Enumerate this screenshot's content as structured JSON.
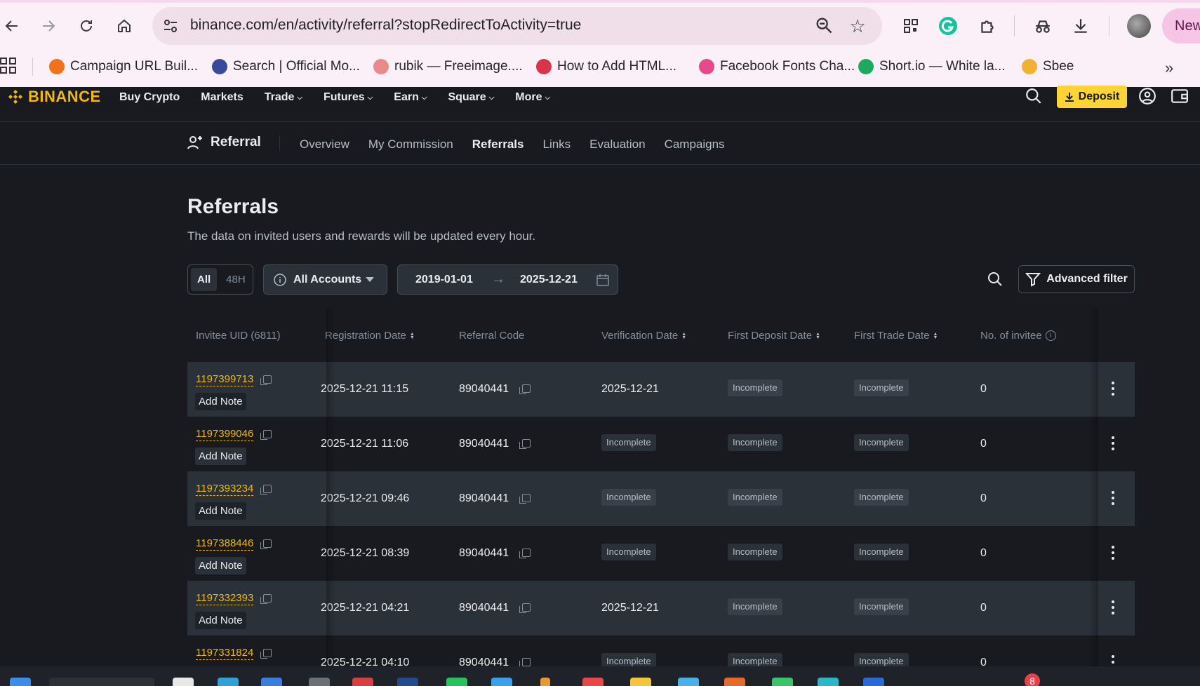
{
  "browser": {
    "url": "binance.com/en/activity/referral?stopRedirectToActivity=true",
    "new_label": "New",
    "bookmarks": [
      {
        "label": "Campaign URL Buil...",
        "color": "#f2711c"
      },
      {
        "label": "Search | Official Mo...",
        "color": "#3a4a9a"
      },
      {
        "label": "rubik — Freeimage....",
        "color": "#e88a8a"
      },
      {
        "label": "How to Add HTML...",
        "color": "#d9344a"
      },
      {
        "label": "Facebook Fonts Cha...",
        "color": "#e64a8c"
      },
      {
        "label": "Short.io — White la...",
        "color": "#1eaa5e"
      },
      {
        "label": "Sbee",
        "color": "#f2b134"
      }
    ]
  },
  "header": {
    "logo": "BINANCE",
    "nav": [
      {
        "label": "Buy Crypto",
        "has_menu": false
      },
      {
        "label": "Markets",
        "has_menu": false
      },
      {
        "label": "Trade",
        "has_menu": true
      },
      {
        "label": "Futures",
        "has_menu": true
      },
      {
        "label": "Earn",
        "has_menu": true
      },
      {
        "label": "Square",
        "has_menu": true
      },
      {
        "label": "More",
        "has_menu": true
      }
    ],
    "deposit_label": "Deposit",
    "accent": "#fcd535"
  },
  "subnav": {
    "title": "Referral",
    "tabs": [
      {
        "label": "Overview",
        "active": false
      },
      {
        "label": "My Commission",
        "active": false
      },
      {
        "label": "Referrals",
        "active": true
      },
      {
        "label": "Links",
        "active": false
      },
      {
        "label": "Evaluation",
        "active": false
      },
      {
        "label": "Campaigns",
        "active": false
      }
    ]
  },
  "page": {
    "title": "Referrals",
    "subtitle": "The data on invited users and rewards will be updated every hour."
  },
  "filters": {
    "range_options": [
      "All",
      "48H"
    ],
    "range_selected": "All",
    "account": "All Accounts",
    "date_from": "2019-01-01",
    "date_to": "2025-12-21",
    "advanced_filter": "Advanced filter"
  },
  "table": {
    "columns": {
      "uid": "Invitee UID (6811)",
      "registration": "Registration Date",
      "code": "Referral Code",
      "verification": "Verification Date",
      "first_deposit": "First Deposit Date",
      "first_trade": "First Trade Date",
      "invitees": "No. of invitee"
    },
    "add_note": "Add Note",
    "incomplete": "Incomplete",
    "rows": [
      {
        "uid": "1197399713",
        "registration": "2025-12-21 11:15",
        "code": "89040441",
        "verification": "2025-12-21",
        "first_deposit": "Incomplete",
        "first_trade": "Incomplete",
        "invitees": "0"
      },
      {
        "uid": "1197399046",
        "registration": "2025-12-21 11:06",
        "code": "89040441",
        "verification": "Incomplete",
        "first_deposit": "Incomplete",
        "first_trade": "Incomplete",
        "invitees": "0"
      },
      {
        "uid": "1197393234",
        "registration": "2025-12-21 09:46",
        "code": "89040441",
        "verification": "Incomplete",
        "first_deposit": "Incomplete",
        "first_trade": "Incomplete",
        "invitees": "0"
      },
      {
        "uid": "1197388446",
        "registration": "2025-12-21 08:39",
        "code": "89040441",
        "verification": "Incomplete",
        "first_deposit": "Incomplete",
        "first_trade": "Incomplete",
        "invitees": "0"
      },
      {
        "uid": "1197332393",
        "registration": "2025-12-21 04:21",
        "code": "89040441",
        "verification": "2025-12-21",
        "first_deposit": "Incomplete",
        "first_trade": "Incomplete",
        "invitees": "0"
      },
      {
        "uid": "1197331824",
        "registration": "2025-12-21 04:10",
        "code": "89040441",
        "verification": "Incomplete",
        "first_deposit": "Incomplete",
        "first_trade": "Incomplete",
        "invitees": "0"
      }
    ]
  },
  "taskbar": {
    "notification_count": "8"
  }
}
